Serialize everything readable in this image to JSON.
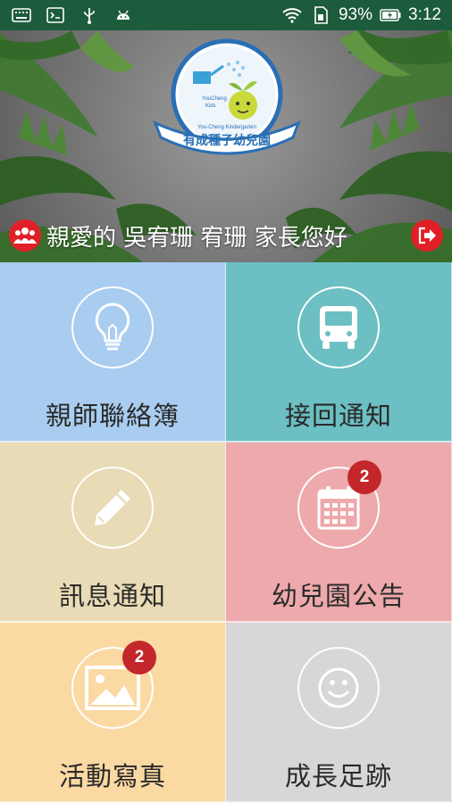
{
  "status_bar": {
    "battery": "93%",
    "time": "3:12",
    "icons": [
      "keyboard-icon",
      "terminal-icon",
      "usb-icon",
      "android-icon",
      "wifi-icon",
      "sim-icon",
      "battery-icon"
    ]
  },
  "header": {
    "logo": {
      "text_lines": [
        "YouCheng",
        "Kids"
      ],
      "banner_text": "有成種子幼兒園",
      "sub_text": "You-Cheng Kindergarten"
    },
    "greeting": "親愛的 吳宥珊 宥珊 家長您好",
    "icons": [
      "parents-icon",
      "logout-icon"
    ]
  },
  "menu": [
    {
      "label": "親師聯絡簿",
      "icon": "lightbulb-icon",
      "badge": null,
      "color": "#a9cdf0"
    },
    {
      "label": "接回通知",
      "icon": "bus-icon",
      "badge": null,
      "color": "#6cbfc3"
    },
    {
      "label": "訊息通知",
      "icon": "pencil-icon",
      "badge": null,
      "color": "#e8dbb5"
    },
    {
      "label": "幼兒園公告",
      "icon": "calendar-icon",
      "badge": "2",
      "color": "#eda9ac"
    },
    {
      "label": "活動寫真",
      "icon": "photo-icon",
      "badge": "2",
      "color": "#fbd9a3"
    },
    {
      "label": "成長足跡",
      "icon": "smiley-icon",
      "badge": null,
      "color": "#d9d6d9"
    }
  ]
}
